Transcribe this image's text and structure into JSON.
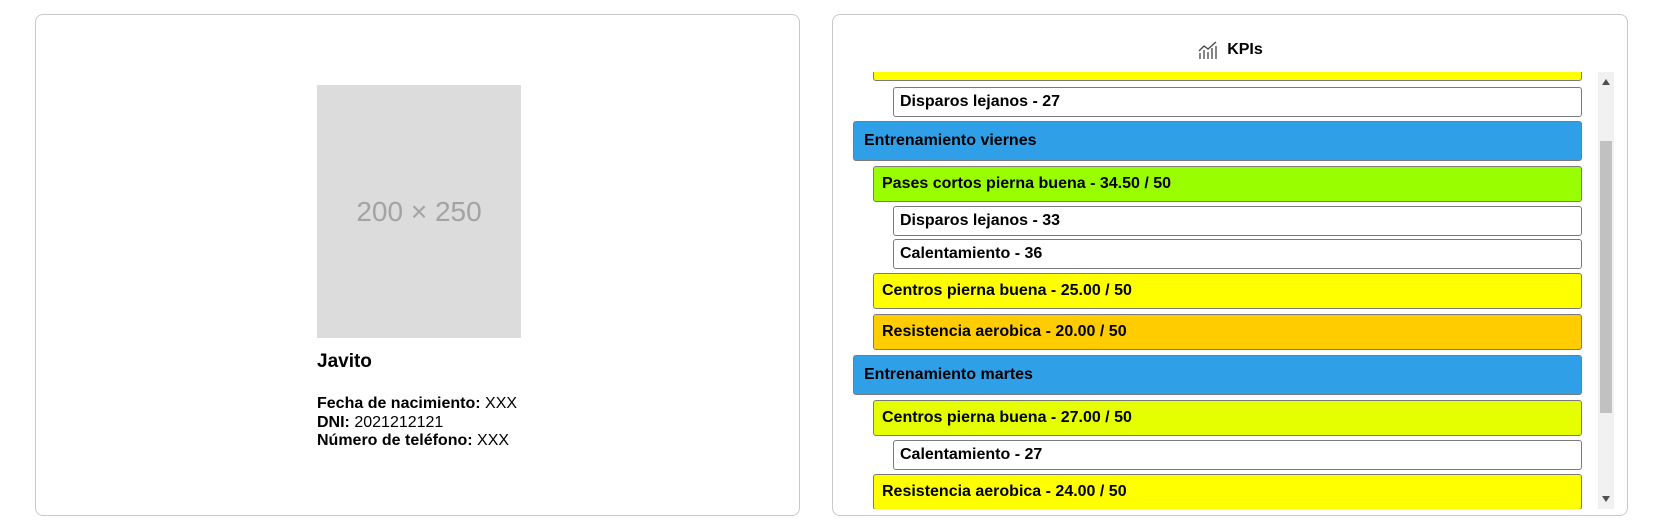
{
  "profile": {
    "photo_placeholder": "200 × 250",
    "name": "Javito",
    "birth_label": "Fecha de nacimiento:",
    "birth_value": "XXX",
    "dni_label": "DNI:",
    "dni_value": "2021212121",
    "phone_label": "Número de teléfono:",
    "phone_value": "XXX"
  },
  "kpis": {
    "title": "KPIs",
    "icon": "chart-line-icon",
    "items": [
      {
        "label": "",
        "level": 1,
        "color": "#ffff00"
      },
      {
        "label": "Disparos lejanos - 27",
        "level": 2,
        "color": "#ffffff"
      },
      {
        "label": "Entrenamiento viernes",
        "level": 0,
        "color": "#2f9fe8"
      },
      {
        "label": "Pases cortos pierna buena - 34.50 / 50",
        "level": 1,
        "color": "#99ff00"
      },
      {
        "label": "Disparos lejanos - 33",
        "level": 2,
        "color": "#ffffff"
      },
      {
        "label": "Calentamiento - 36",
        "level": 2,
        "color": "#ffffff"
      },
      {
        "label": "Centros pierna buena - 25.00 / 50",
        "level": 1,
        "color": "#ffff00"
      },
      {
        "label": "Resistencia aerobica - 20.00 / 50",
        "level": 1,
        "color": "#ffcc00"
      },
      {
        "label": "Entrenamiento martes",
        "level": 0,
        "color": "#2f9fe8"
      },
      {
        "label": "Centros pierna buena - 27.00 / 50",
        "level": 1,
        "color": "#e5ff00"
      },
      {
        "label": "Calentamiento - 27",
        "level": 2,
        "color": "#ffffff"
      },
      {
        "label": "Resistencia aerobica - 24.00 / 50",
        "level": 1,
        "color": "#ffff00"
      }
    ]
  }
}
